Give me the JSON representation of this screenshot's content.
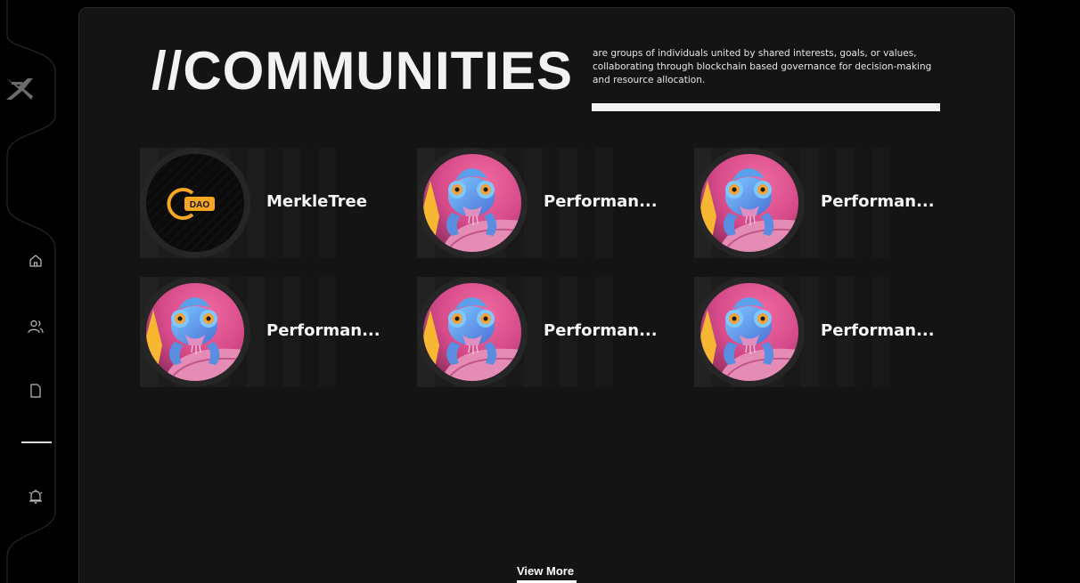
{
  "hero": {
    "title": "//COMMUNITIES",
    "description": "are groups of individuals united by shared interests, goals, or values, collaborating through blockchain based governance for decision-making and resource allocation."
  },
  "nav": {
    "items": [
      {
        "icon": "home-icon"
      },
      {
        "icon": "users-icon"
      },
      {
        "icon": "file-icon"
      },
      {
        "icon": "bell-icon"
      }
    ]
  },
  "communities": [
    {
      "name": "MerkleTree",
      "avatar": "dao-logo",
      "badge": "DAO"
    },
    {
      "name": "Performan...",
      "avatar": "chameleon"
    },
    {
      "name": "Performan...",
      "avatar": "chameleon"
    },
    {
      "name": "Performan...",
      "avatar": "chameleon"
    },
    {
      "name": "Performan...",
      "avatar": "chameleon"
    },
    {
      "name": "Performan...",
      "avatar": "chameleon"
    }
  ],
  "actions": {
    "view_more": "View More"
  },
  "colors": {
    "background": "#000000",
    "panel": "#141414",
    "accent_orange": "#f5a623",
    "text": "#ffffff"
  }
}
